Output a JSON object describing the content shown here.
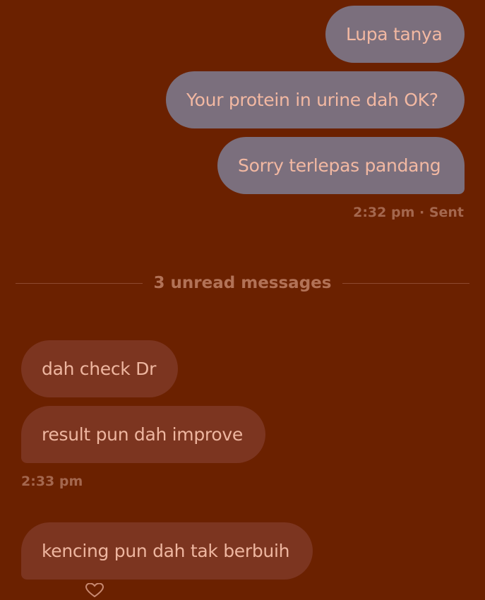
{
  "colors": {
    "background": "#6b2100",
    "sent_bubble": "#7b6f7d",
    "received_bubble": "#7c3520",
    "sent_text": "#f2b8a2",
    "received_text": "#eeb6a0",
    "meta_text": "#a4674e"
  },
  "sent_messages": [
    {
      "text": "Lupa tanya"
    },
    {
      "text": "Your protein in urine dah OK?"
    },
    {
      "text": "Sorry terlepas pandang"
    }
  ],
  "sent_meta": "2:32 pm · Sent",
  "unread_divider": "3 unread messages",
  "received_messages": [
    {
      "text": "dah check Dr"
    },
    {
      "text": "result pun dah improve"
    },
    {
      "text": "kencing pun dah tak berbuih"
    }
  ],
  "received_meta": "2:33 pm",
  "reaction": {
    "icon": "heart-icon"
  }
}
